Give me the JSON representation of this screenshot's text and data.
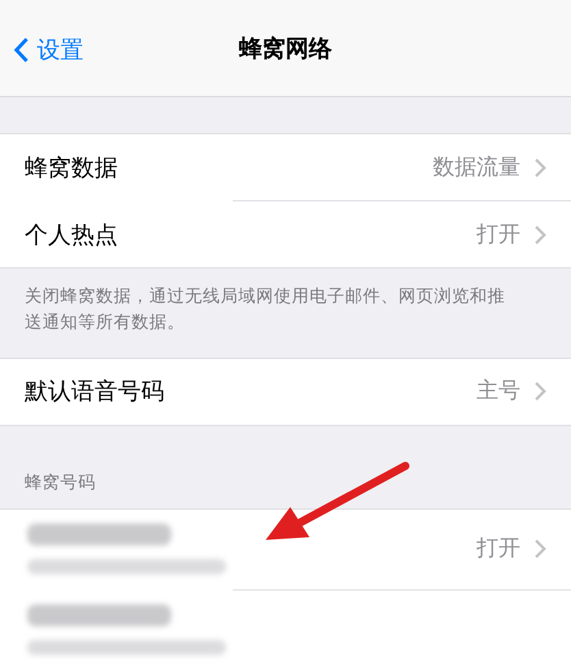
{
  "nav": {
    "back": "设置",
    "title": "蜂窝网络"
  },
  "groups": [
    {
      "rows": [
        {
          "kind": "link",
          "label": "蜂窝数据",
          "value": "数据流量"
        },
        {
          "kind": "link",
          "label": "个人热点",
          "value": "打开"
        }
      ],
      "footer": "关闭蜂窝数据，通过无线局域网使用电子邮件、网页浏览和推送通知等所有数据。"
    },
    {
      "rows": [
        {
          "kind": "link",
          "label": "默认语音号码",
          "value": "主号"
        }
      ]
    },
    {
      "header": "蜂窝号码",
      "rows": [
        {
          "kind": "redacted",
          "value": "打开"
        },
        {
          "kind": "redacted"
        }
      ]
    }
  ]
}
